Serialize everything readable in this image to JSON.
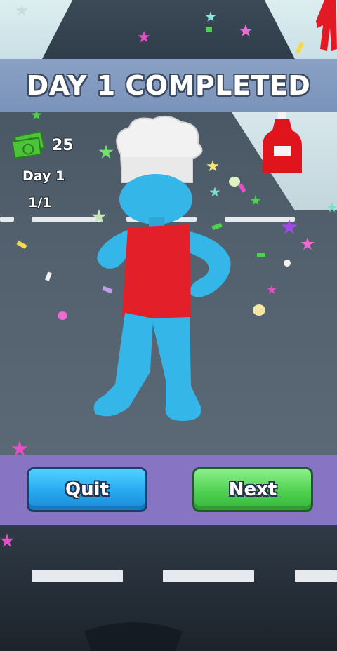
{
  "banner": {
    "title": "DAY 1 COMPLETED"
  },
  "hud": {
    "money_icon": "cash-stack-icon",
    "money": "25",
    "day": "Day 1",
    "progress": "1/1"
  },
  "buttons": {
    "quit_label": "Quit",
    "next_label": "Next"
  },
  "colors": {
    "banner": "#7f97bf",
    "button_bar": "#8774c3",
    "quit_button": "#27a8f0",
    "next_button": "#4fd150",
    "character_skin": "#34b6e8",
    "apron": "#e3202a"
  }
}
